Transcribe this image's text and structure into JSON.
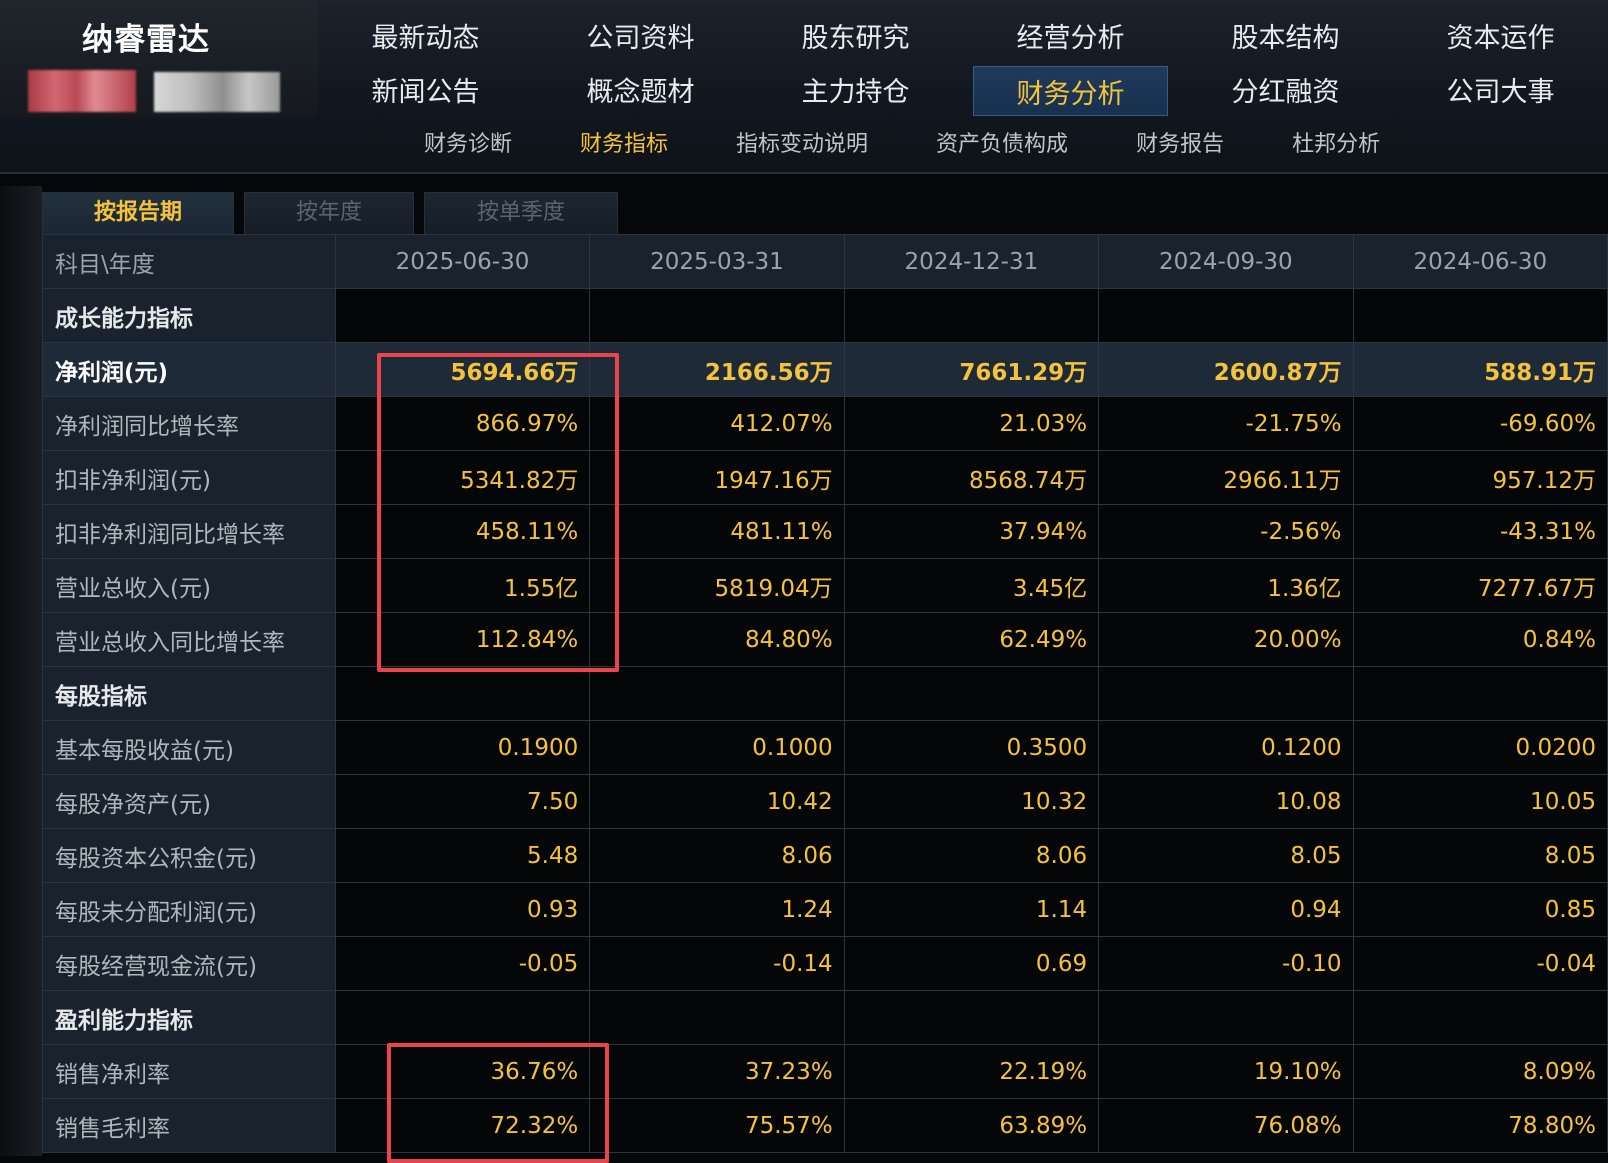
{
  "brand": {
    "title": "纳睿雷达"
  },
  "nav_main": [
    {
      "label": "最新动态"
    },
    {
      "label": "公司资料"
    },
    {
      "label": "股东研究"
    },
    {
      "label": "经营分析"
    },
    {
      "label": "股本结构"
    },
    {
      "label": "资本运作"
    },
    {
      "label": "新闻公告"
    },
    {
      "label": "概念题材"
    },
    {
      "label": "主力持仓"
    },
    {
      "label": "财务分析",
      "active": true
    },
    {
      "label": "分红融资"
    },
    {
      "label": "公司大事"
    }
  ],
  "nav_sub": [
    {
      "label": "财务诊断"
    },
    {
      "label": "财务指标",
      "active": true
    },
    {
      "label": "指标变动说明"
    },
    {
      "label": "资产负债构成"
    },
    {
      "label": "财务报告"
    },
    {
      "label": "杜邦分析"
    }
  ],
  "tabs": [
    {
      "label": "按报告期",
      "active": true
    },
    {
      "label": "按年度"
    },
    {
      "label": "按单季度"
    }
  ],
  "table": {
    "header": "科目\\年度",
    "periods": [
      "2025-06-30",
      "2025-03-31",
      "2024-12-31",
      "2024-09-30",
      "2024-06-30"
    ],
    "rows": [
      {
        "type": "section",
        "label": "成长能力指标"
      },
      {
        "type": "highlight",
        "label": "净利润(元)",
        "values": [
          "5694.66万",
          "2166.56万",
          "7661.29万",
          "2600.87万",
          "588.91万"
        ]
      },
      {
        "type": "data",
        "label": "净利润同比增长率",
        "values": [
          "866.97%",
          "412.07%",
          "21.03%",
          "-21.75%",
          "-69.60%"
        ]
      },
      {
        "type": "data",
        "label": "扣非净利润(元)",
        "values": [
          "5341.82万",
          "1947.16万",
          "8568.74万",
          "2966.11万",
          "957.12万"
        ]
      },
      {
        "type": "data",
        "label": "扣非净利润同比增长率",
        "values": [
          "458.11%",
          "481.11%",
          "37.94%",
          "-2.56%",
          "-43.31%"
        ]
      },
      {
        "type": "data",
        "label": "营业总收入(元)",
        "values": [
          "1.55亿",
          "5819.04万",
          "3.45亿",
          "1.36亿",
          "7277.67万"
        ]
      },
      {
        "type": "data",
        "label": "营业总收入同比增长率",
        "values": [
          "112.84%",
          "84.80%",
          "62.49%",
          "20.00%",
          "0.84%"
        ]
      },
      {
        "type": "section",
        "label": "每股指标"
      },
      {
        "type": "data",
        "label": "基本每股收益(元)",
        "values": [
          "0.1900",
          "0.1000",
          "0.3500",
          "0.1200",
          "0.0200"
        ]
      },
      {
        "type": "data",
        "label": "每股净资产(元)",
        "values": [
          "7.50",
          "10.42",
          "10.32",
          "10.08",
          "10.05"
        ]
      },
      {
        "type": "data",
        "label": "每股资本公积金(元)",
        "values": [
          "5.48",
          "8.06",
          "8.06",
          "8.05",
          "8.05"
        ]
      },
      {
        "type": "data",
        "label": "每股未分配利润(元)",
        "values": [
          "0.93",
          "1.24",
          "1.14",
          "0.94",
          "0.85"
        ]
      },
      {
        "type": "data",
        "label": "每股经营现金流(元)",
        "values": [
          "-0.05",
          "-0.14",
          "0.69",
          "-0.10",
          "-0.04"
        ]
      },
      {
        "type": "section",
        "label": "盈利能力指标"
      },
      {
        "type": "data",
        "label": "销售净利率",
        "values": [
          "36.76%",
          "37.23%",
          "22.19%",
          "19.10%",
          "8.09%"
        ]
      },
      {
        "type": "data",
        "label": "销售毛利率",
        "values": [
          "72.32%",
          "75.57%",
          "63.89%",
          "76.08%",
          "78.80%"
        ]
      }
    ]
  },
  "colors": {
    "accent": "#f5c33b",
    "highlight_box": "#e8454d",
    "active_nav_bg": "#1f3a5b"
  }
}
